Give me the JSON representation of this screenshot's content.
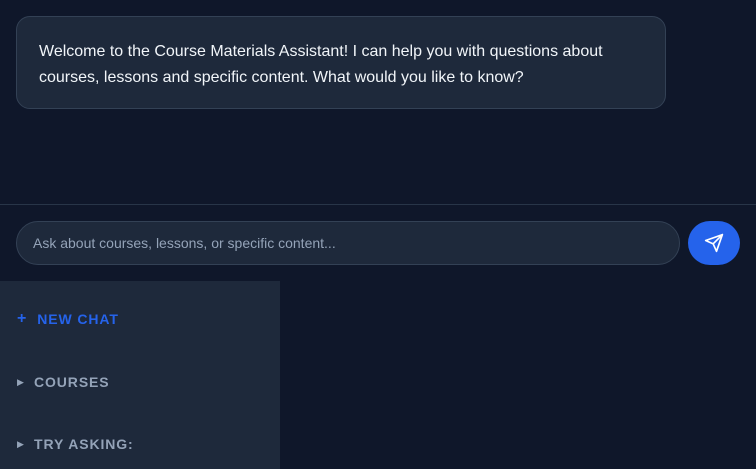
{
  "chat": {
    "welcome_message": "Welcome to the Course Materials Assistant! I can help you with questions about courses, lessons and specific content. What would you like to know?"
  },
  "input": {
    "placeholder": "Ask about courses, lessons, or specific content...",
    "value": ""
  },
  "send_button": {
    "icon": "send-icon"
  },
  "sidebar": {
    "new_chat": {
      "icon": "+",
      "label": "NEW CHAT"
    },
    "sections": [
      {
        "icon": "▶",
        "label": "COURSES"
      },
      {
        "icon": "▶",
        "label": "TRY ASKING:"
      }
    ]
  },
  "colors": {
    "background": "#0f172a",
    "surface": "#1e293b",
    "border": "#334155",
    "accent": "#2563eb",
    "text": "#f1f5f9",
    "muted": "#94a3b8"
  }
}
